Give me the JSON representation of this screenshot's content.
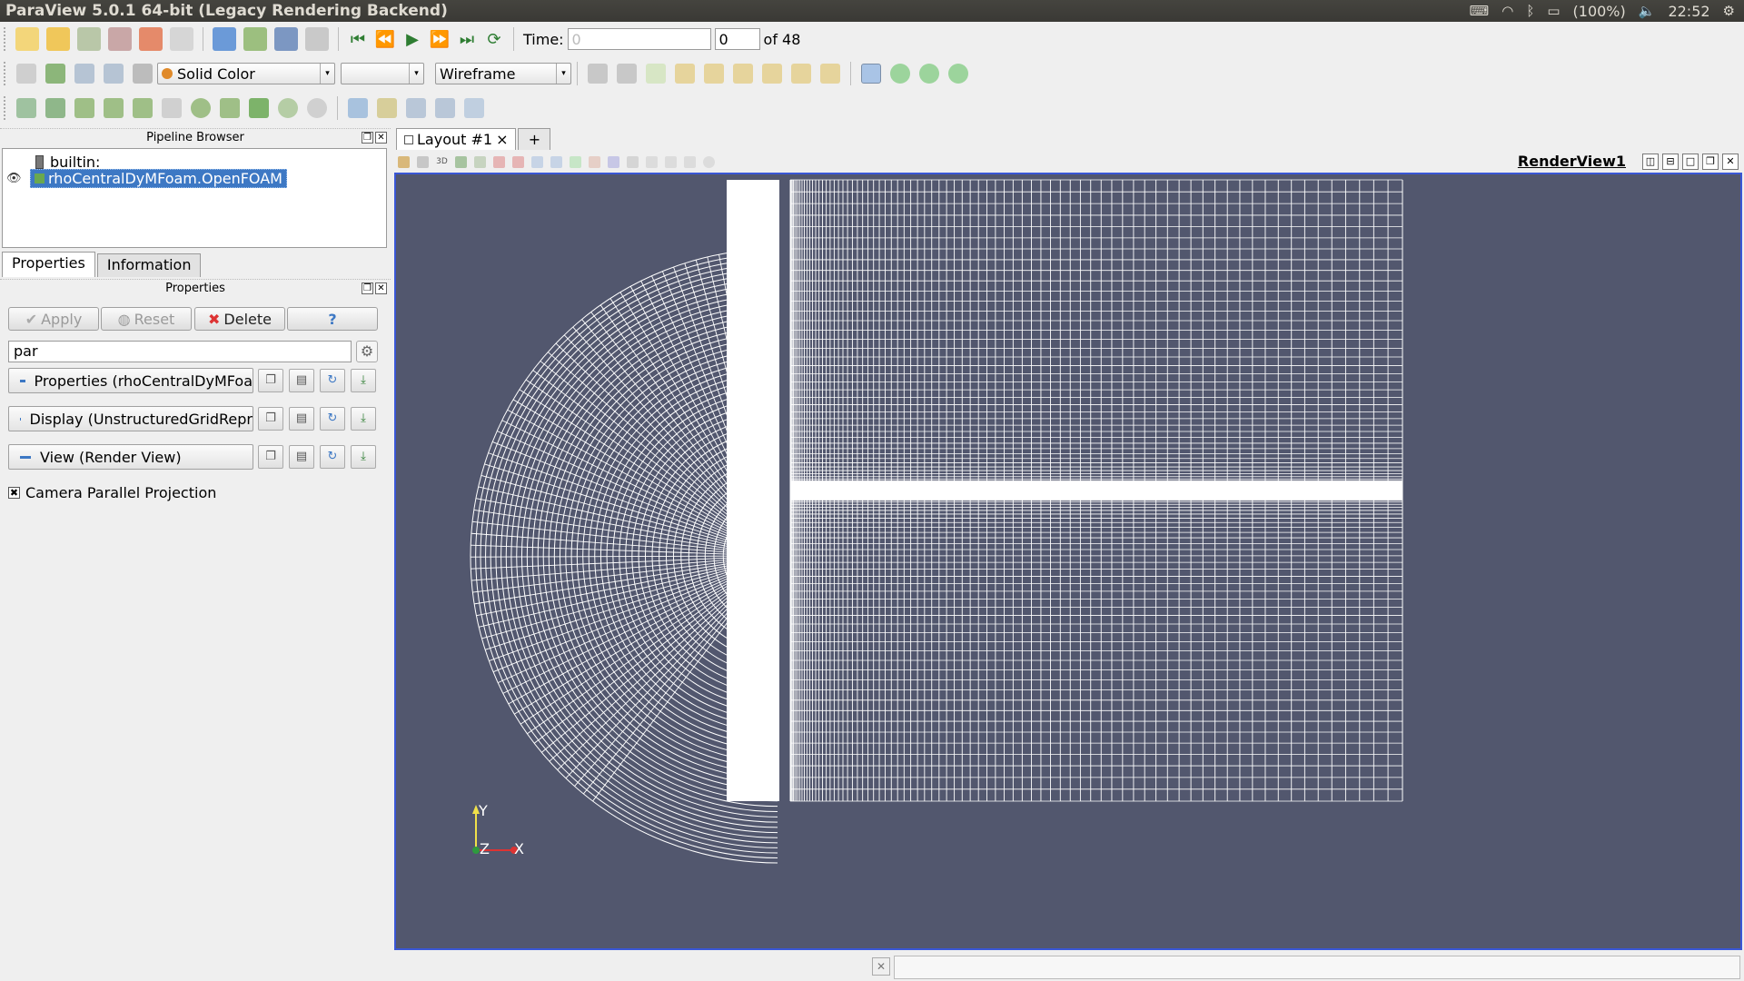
{
  "window": {
    "title": "ParaView 5.0.1 64-bit (Legacy Rendering Backend)"
  },
  "tray": {
    "battery": "(100%)",
    "clock": "22:52"
  },
  "toolbar": {
    "time_label": "Time:",
    "time_value": "0",
    "timestep_value": "0",
    "timestep_total": "of 48",
    "color_by": "Solid Color",
    "component": "",
    "representation": "Wireframe"
  },
  "pipeline": {
    "title": "Pipeline Browser",
    "items": [
      {
        "label": "builtin:"
      },
      {
        "label": "rhoCentralDyMFoam.OpenFOAM"
      }
    ]
  },
  "tabs": {
    "properties": "Properties",
    "information": "Information"
  },
  "properties": {
    "title": "Properties",
    "apply": "Apply",
    "reset": "Reset",
    "delete": "Delete",
    "help": "?",
    "search_value": "par",
    "sections": [
      {
        "label": "Properties (rhoCentralDyMFoa"
      },
      {
        "label": "Display (UnstructuredGridRepr"
      },
      {
        "label": "View (Render View)"
      }
    ],
    "camera_parallel": "Camera Parallel Projection",
    "camera_parallel_checked": "✖"
  },
  "layout": {
    "tab": "Layout #1",
    "close": "×",
    "add": "+"
  },
  "render_view": {
    "label": "RenderView1",
    "view3d": "3D"
  },
  "axes": {
    "y": "Y",
    "z": "Z",
    "x": "X"
  },
  "colors": {
    "background": "#52576e",
    "mesh": "#ffffff",
    "selection": "#3d78c4"
  }
}
